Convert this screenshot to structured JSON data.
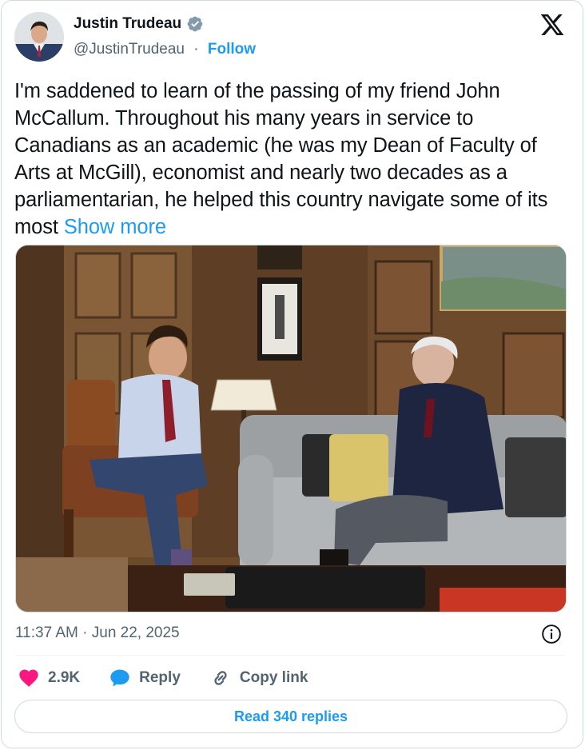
{
  "author": {
    "name": "Justin Trudeau",
    "handle": "@JustinTrudeau",
    "separator": "·",
    "follow_label": "Follow",
    "verified_icon": "verified-badge-icon"
  },
  "platform_logo": "x-logo-icon",
  "tweet": {
    "text": "I'm saddened to learn of the passing of my friend John McCallum. Throughout his many years in service to Canadians as an academic (he was my Dean of Faculty of Arts at McGill), economist and nearly two decades as a parliamentarian, he helped this country navigate some of its most",
    "show_more_label": "Show more"
  },
  "meta": {
    "timestamp": "11:37 AM · Jun 22, 2025",
    "info_icon": "info-icon"
  },
  "actions": {
    "likes": {
      "icon": "heart-icon",
      "label": "2.9K",
      "color": "#f91880"
    },
    "reply": {
      "icon": "reply-bubble-icon",
      "label": "Reply",
      "color": "#1d9bf0"
    },
    "copy": {
      "icon": "link-icon",
      "label": "Copy link"
    }
  },
  "read_replies_label": "Read 340 replies",
  "colors": {
    "accent": "#1d9bf0",
    "text_primary": "#0f1419",
    "text_secondary": "#536471",
    "border": "#cfd9de"
  }
}
